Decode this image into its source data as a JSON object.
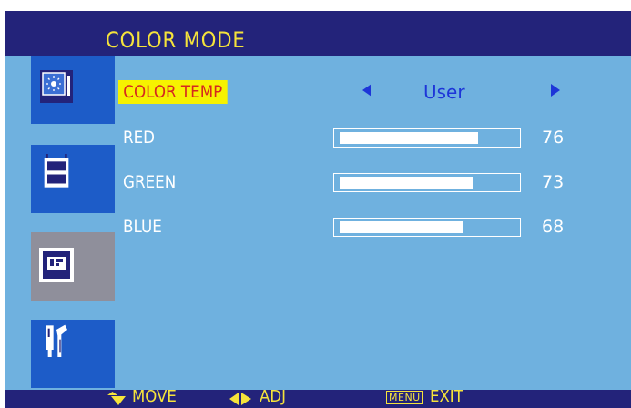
{
  "menu": {
    "title": "COLOR MODE"
  },
  "sidebar": {
    "items": [
      {
        "icon": "picture-brightness-icon",
        "active": false
      },
      {
        "icon": "film-strip-icon",
        "active": false
      },
      {
        "icon": "screen-position-icon",
        "active": true
      },
      {
        "icon": "tools-icon",
        "active": false
      }
    ]
  },
  "color_temp": {
    "label": "COLOR TEMP",
    "value": "User"
  },
  "sliders": [
    {
      "label": "RED",
      "value": "76",
      "level": 0.76
    },
    {
      "label": "GREEN",
      "value": "73",
      "level": 0.73
    },
    {
      "label": "BLUE",
      "value": "68",
      "level": 0.68
    }
  ],
  "hints": {
    "move": "MOVE",
    "adj": "ADJ",
    "menu_key": "MENU",
    "exit": "EXIT"
  },
  "colors": {
    "panel": "#6fb1df",
    "bar": "#23237a",
    "accent_yellow": "#f5e33b",
    "tab_blue": "#1d5cc8",
    "highlight": "#f6f200",
    "highlight_text": "#d6281f"
  }
}
